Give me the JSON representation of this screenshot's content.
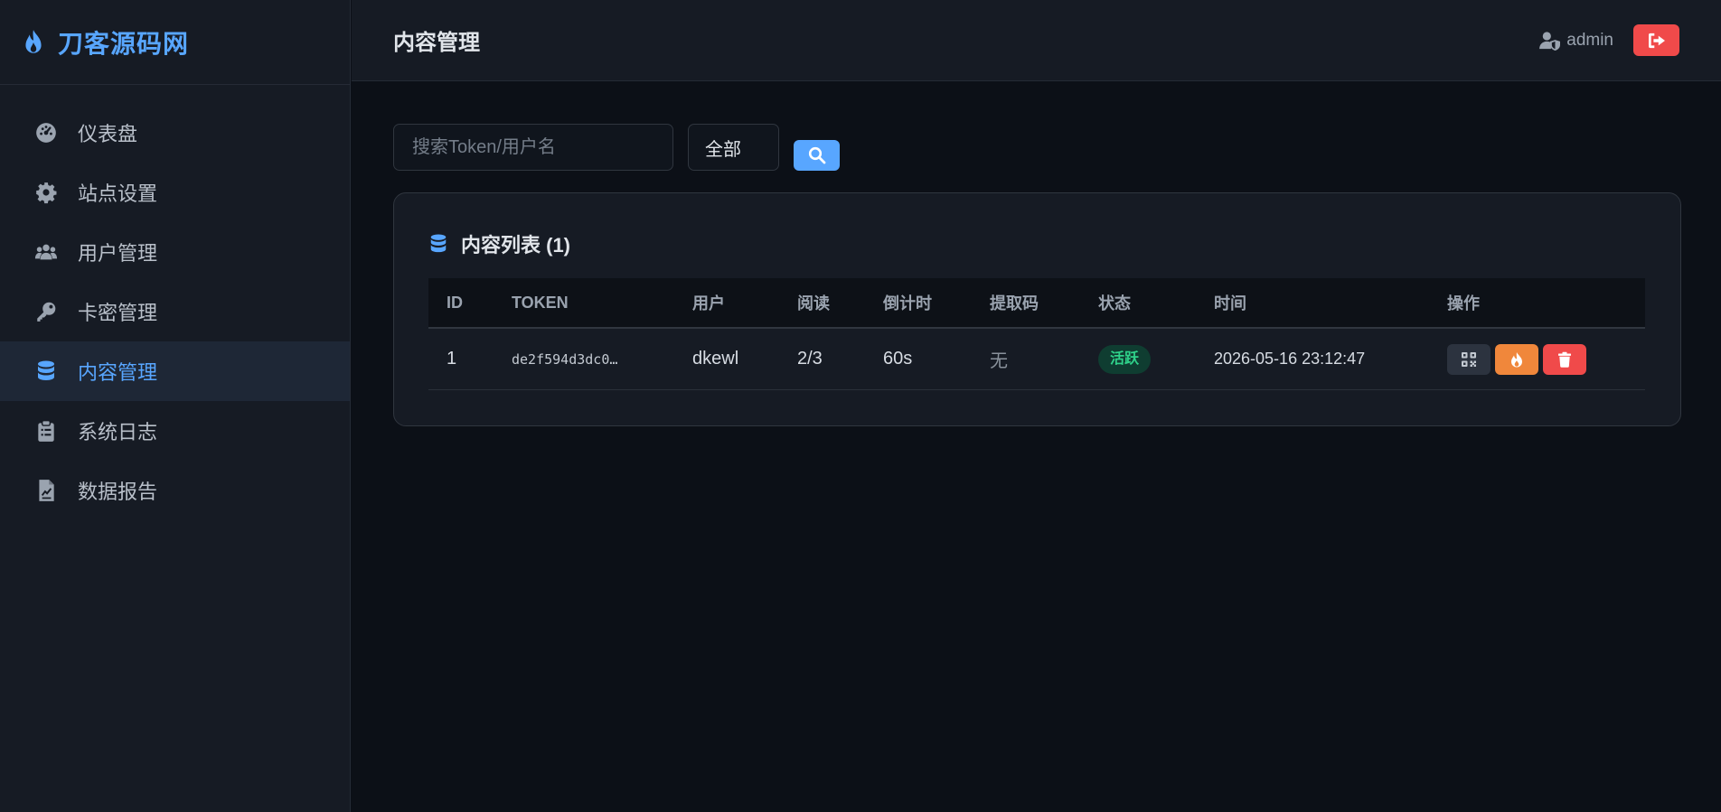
{
  "sidebar": {
    "brand": "刀客源码网",
    "items": [
      {
        "label": "仪表盘",
        "icon": "gauge-icon"
      },
      {
        "label": "站点设置",
        "icon": "gear-icon"
      },
      {
        "label": "用户管理",
        "icon": "users-icon"
      },
      {
        "label": "卡密管理",
        "icon": "key-icon"
      },
      {
        "label": "内容管理",
        "icon": "database-icon",
        "active": true
      },
      {
        "label": "系统日志",
        "icon": "clipboard-icon"
      },
      {
        "label": "数据报告",
        "icon": "report-icon"
      }
    ]
  },
  "header": {
    "title": "内容管理",
    "username": "admin"
  },
  "filters": {
    "search_placeholder": "搜索Token/用户名",
    "status_select": "全部"
  },
  "content": {
    "title": "内容列表 (1)",
    "columns": [
      "ID",
      "TOKEN",
      "用户",
      "阅读",
      "倒计时",
      "提取码",
      "状态",
      "时间",
      "操作"
    ],
    "rows": [
      {
        "id": "1",
        "token": "de2f594d3dc0…",
        "user": "dkewl",
        "reads": "2/3",
        "countdown": "60s",
        "code": "无",
        "status": "活跃",
        "time": "2026-05-16 23:12:47"
      }
    ]
  },
  "colors": {
    "accent": "#58a6ff",
    "danger": "#f04a4a",
    "warning": "#f0873b",
    "success": "#2fd28a",
    "background": "#0c1017",
    "panel": "#161b24"
  }
}
